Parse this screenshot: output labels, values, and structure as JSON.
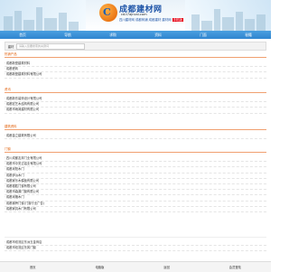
{
  "header": {
    "logo_mark": "C",
    "title": "成都建材网",
    "url": "cd.t7ajncai.com",
    "slogan_left": "四川建材网 成都商铺 成都建材 建材网",
    "slogan_badge": "手机版"
  },
  "nav": [
    "首页",
    "导航",
    "求购",
    "资料",
    "门面",
    "秘籍"
  ],
  "search": {
    "label": "建材",
    "placeholder": "请输入您要搜索的关键词"
  },
  "sections": [
    {
      "heading": "热销产品",
      "items": [
        "成都新型建筑材料",
        "成都瓷砖",
        "成都新型建筑材料有限公司"
      ]
    },
    {
      "heading": "资讯",
      "items": [
        "成都新东装饰设计有限公司",
        "成都宏艺木结构有限公司",
        "成都市雨润建材有限公司"
      ]
    },
    {
      "heading": "建筑资料",
      "items": [
        "成都金立建筑有限公司"
      ]
    },
    {
      "heading": "门窗",
      "items": [
        "四川成都友邦门业有限公司",
        "成都市中安达铝业有限公司",
        "成都米阳木门",
        "成都伊派木门",
        "成都家乐木模板有限公司",
        "成都德胜门窗有限公司",
        "成都市森源门窗有限公司",
        "成都米格木门",
        "成都钢骨门窗(门窗行业广告)",
        "成都家具木门有限公司"
      ]
    },
    {
      "heading": "",
      "items": [
        "成都市双流区东洲五金商店",
        "成都市双流区东风门窗"
      ]
    }
  ],
  "footer": [
    "首页",
    "电脑版",
    "返回",
    "会员登陆"
  ]
}
